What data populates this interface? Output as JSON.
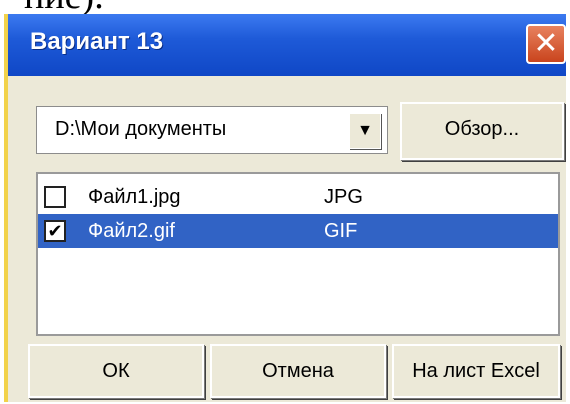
{
  "document": {
    "text_fragment": "ние)."
  },
  "window": {
    "title": "Вариант 13",
    "close_glyph": "✕"
  },
  "path": {
    "value": "D:\\Мои документы",
    "arrow_glyph": "▼"
  },
  "browse_label": "Обзор...",
  "files": [
    {
      "name": "Файл1.jpg",
      "type": "JPG",
      "checked": false,
      "check_glyph": "",
      "selected": false
    },
    {
      "name": "Файл2.gif",
      "type": "GIF",
      "checked": true,
      "check_glyph": "✔",
      "selected": true
    }
  ],
  "buttons": {
    "ok": "ОК",
    "cancel": "Отмена",
    "excel": "На лист Excel"
  },
  "colors": {
    "titlebar": "#1e5ad8",
    "selection": "#3163c5",
    "dialog_bg": "#ece9d8",
    "close_button": "#d3552b"
  }
}
